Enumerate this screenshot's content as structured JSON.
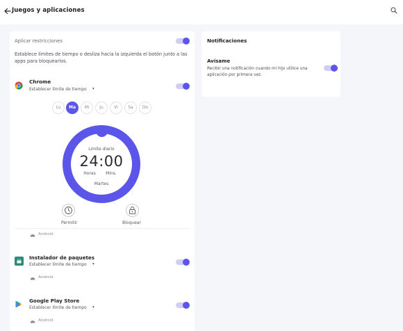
{
  "header": {
    "title": "Juegos y aplicaciones"
  },
  "restrictions": {
    "label": "Aplicar restricciones",
    "enabled": true,
    "description": "Establece límites de tiempo o desliza hacia la izquierda el botón junto a las apps para bloquearlos."
  },
  "apps": [
    {
      "name": "Chrome",
      "subtitle": "Establecer límite de tiempo",
      "os": "Android",
      "enabled": true,
      "days": [
        "Lu",
        "Ma",
        "Mi",
        "Ju",
        "Vi",
        "Sa",
        "Do"
      ],
      "selected_day": "Ma",
      "limit": {
        "label": "Límite diario",
        "time": "24:00",
        "hours_label": "Horas",
        "mins_label": "Mins.",
        "day_name": "Martes"
      },
      "actions": {
        "allow": "Permitir",
        "block": "Bloquear"
      }
    },
    {
      "name": "Instalador de paquetes",
      "subtitle": "Establecer límite de tiempo",
      "os": "Android",
      "enabled": true
    },
    {
      "name": "Google Play Store",
      "subtitle": "Establecer límite de tiempo",
      "os": "Android",
      "enabled": true
    }
  ],
  "notifications": {
    "title": "Notificaciones",
    "item_title": "Avísame",
    "item_desc": "Recibir una notificación cuando mi hijo utilice una aplicación por primera vez.",
    "enabled": true
  },
  "colors": {
    "accent": "#5b55ea",
    "accent_light": "#cfcdf6",
    "background": "#f5f6fa"
  }
}
